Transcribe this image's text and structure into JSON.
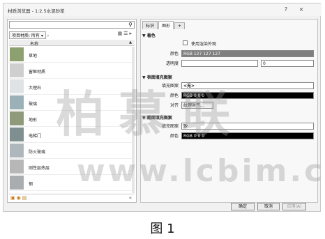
{
  "window": {
    "title": "材质浏览器 - 1:2.5水泥砂浆",
    "help": "?",
    "close": "×"
  },
  "left": {
    "search_value": "",
    "filter_label": "项目材质: 所有",
    "column_name": "名称",
    "items": [
      {
        "label": "草地",
        "color": "#8da06f"
      },
      {
        "label": "窗框材质",
        "color": "#cfcfcf"
      },
      {
        "label": "大理石",
        "color": "#dfe3e3"
      },
      {
        "label": "玻璃",
        "color": "#9cb0b8"
      },
      {
        "label": "地形",
        "color": "#8e9a7a"
      },
      {
        "label": "电梯门",
        "color": "#7f8f8f"
      },
      {
        "label": "防火玻璃",
        "color": "#aeb8bc"
      },
      {
        "label": "刚性层热层",
        "color": "#b7b7b7"
      },
      {
        "label": "钢",
        "color": "#a9adb0"
      }
    ],
    "collapse": "«"
  },
  "right": {
    "tabs": [
      "标识",
      "图形",
      "+"
    ],
    "shading": {
      "title": "着色",
      "use_render": "使用渲染外观",
      "color_label": "颜色",
      "color_value": "RGB 127 127 127",
      "color_hex": "#7f7f7f",
      "transparency_label": "透明度",
      "transparency_value": "0"
    },
    "surface": {
      "title": "表面填充图案",
      "pattern_label": "填充图案",
      "pattern_value": "<无>",
      "color_label": "颜色",
      "color_value": "RGB 0 0 0",
      "align_label": "对齐",
      "align_value": "纹理对齐..."
    },
    "cut": {
      "title": "截面填充图案",
      "pattern_label": "填充图案",
      "pattern_value": "沙",
      "color_label": "颜色",
      "color_value": "RGB 0 0 0"
    }
  },
  "buttons": {
    "ok": "确定",
    "cancel": "取消",
    "apply": "应用(A)"
  },
  "caption": "图 1",
  "watermark": {
    "line1": "柏慕联",
    "line2": "www.lcbim.c"
  }
}
